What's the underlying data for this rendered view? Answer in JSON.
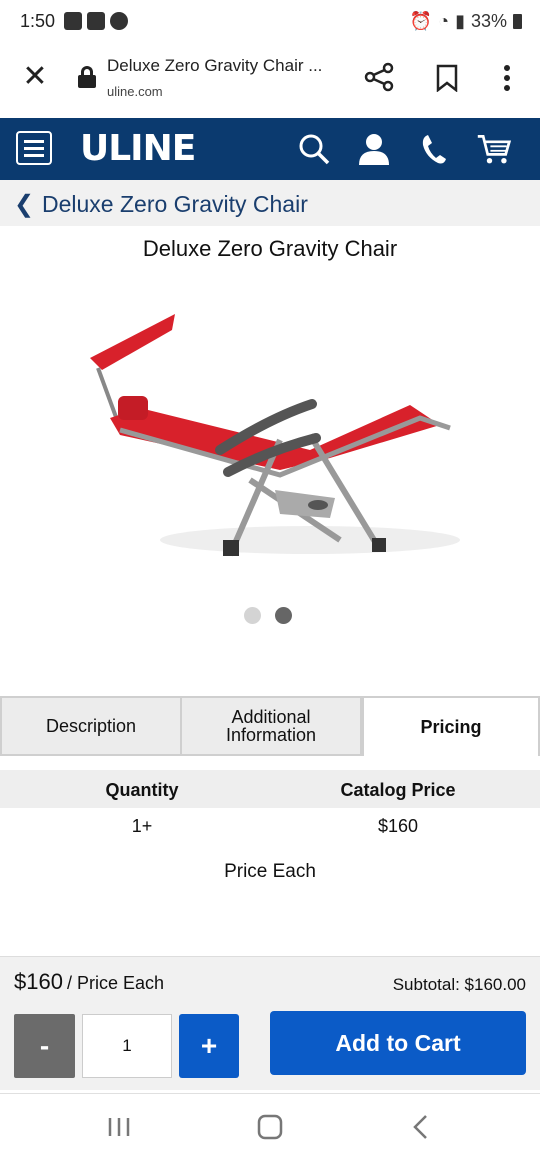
{
  "status_bar": {
    "time": "1:50",
    "battery": "33%"
  },
  "browser": {
    "page_title": "Deluxe Zero Gravity Chair ...",
    "url": "uline.com"
  },
  "navbar": {
    "logo": "ULINE"
  },
  "breadcrumb": {
    "label": "Deluxe Zero Gravity Chair"
  },
  "product": {
    "title": "Deluxe Zero Gravity Chair",
    "carousel_total": 2,
    "carousel_active": 2
  },
  "tabs": [
    {
      "label": "Description"
    },
    {
      "label": "Additional Information"
    },
    {
      "label": "Pricing"
    }
  ],
  "pricing": {
    "col_quantity": "Quantity",
    "col_price": "Catalog Price",
    "rows": [
      {
        "quantity": "1+",
        "price": "$160"
      }
    ],
    "note": "Price Each"
  },
  "cart": {
    "unit_price": "$160",
    "unit_suffix": "/ Price Each",
    "subtotal": "Subtotal: $160.00",
    "minus_label": "-",
    "quantity": "1",
    "plus_label": "+",
    "add_to_cart_label": "Add to Cart"
  },
  "colors": {
    "navbar": "#0b3a6f",
    "button_blue": "#0b5bc7",
    "minus_gray": "#6b6b6b",
    "breadcrumb_text": "#1a3e6e"
  }
}
